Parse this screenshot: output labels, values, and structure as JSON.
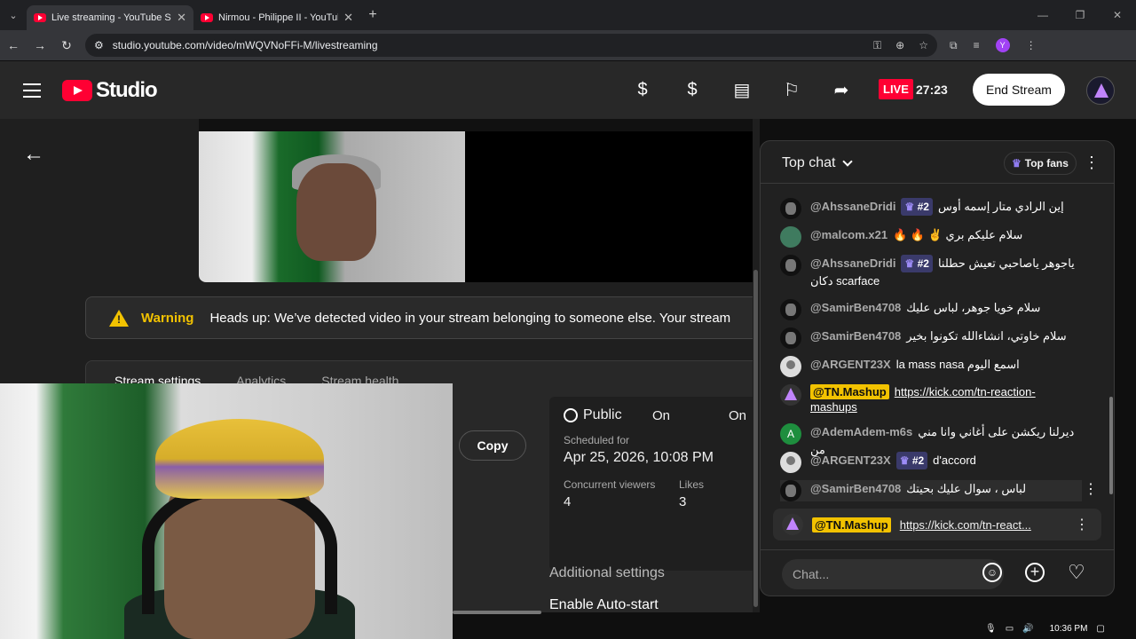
{
  "browser": {
    "tabs": [
      {
        "title": "Live streaming - YouTube Studio",
        "active": true
      },
      {
        "title": "Nirmou - Philippe II - YouTube",
        "active": false
      }
    ],
    "url": "studio.youtube.com/video/mWQVNoFFi-M/livestreaming",
    "profile_initial": "Y"
  },
  "header": {
    "logo_text": "Studio",
    "live_label": "LIVE",
    "timer": "27:23",
    "end_stream_label": "End Stream"
  },
  "warning": {
    "label": "Warning",
    "text": "Heads up: We’ve detected video in your stream belonging to someone else. Your stream"
  },
  "stream_panel": {
    "tabs": [
      "Stream settings",
      "Analytics",
      "Stream health"
    ],
    "copy_label": "Copy",
    "visibility": "Public",
    "on_1": "On",
    "on_2": "On",
    "scheduled_label": "Scheduled for",
    "scheduled_value": "Apr 25, 2026, 10:08 PM",
    "viewers_label": "Concurrent viewers",
    "viewers_value": "4",
    "likes_label": "Likes",
    "likes_value": "3",
    "additional_settings": "Additional settings",
    "auto_start": "Enable Auto-start"
  },
  "chat": {
    "title": "Top chat",
    "top_fans_label": "Top fans",
    "messages": [
      {
        "user": "@AhssaneDridi",
        "badge": "#2",
        "text": "إين الرادي متار إسمه أوس"
      },
      {
        "user": "@malcom.x21",
        "badge": "",
        "text": "🔥 🔥 ✌️ سلام عليكم بري"
      },
      {
        "user": "@AhssaneDridi",
        "badge": "#2",
        "text": "ياجوهر ياصاحبي تعيش حطلنا دكان scarface"
      },
      {
        "user": "@SamirBen4708",
        "badge": "",
        "text": "سلام خويا جوهر، لباس عليك"
      },
      {
        "user": "@SamirBen4708",
        "badge": "",
        "text": "سلام خاوتي، انشاءالله تكونوا بخير"
      },
      {
        "user": "@ARGENT23X",
        "badge": "",
        "text": "la mass nasa اسمع اليوم"
      },
      {
        "user": "@TN.Mashup",
        "badge": "",
        "text": "https://kick.com/tn-reaction-mashups"
      },
      {
        "user": "@AdemAdem-m6s",
        "badge": "",
        "text": "ديرلنا ريكشن على أغاني وانا مني من"
      },
      {
        "user": "@ARGENT23X",
        "badge": "#2",
        "text": "d'accord"
      },
      {
        "user": "@SamirBen4708",
        "badge": "",
        "text": "لباس ، سوال عليك بحيتك"
      }
    ],
    "pinned": {
      "user": "@TN.Mashup",
      "text": "https://kick.com/tn-react..."
    },
    "input_placeholder": "Chat..."
  },
  "taskbar": {
    "time": "10:36 PM"
  }
}
